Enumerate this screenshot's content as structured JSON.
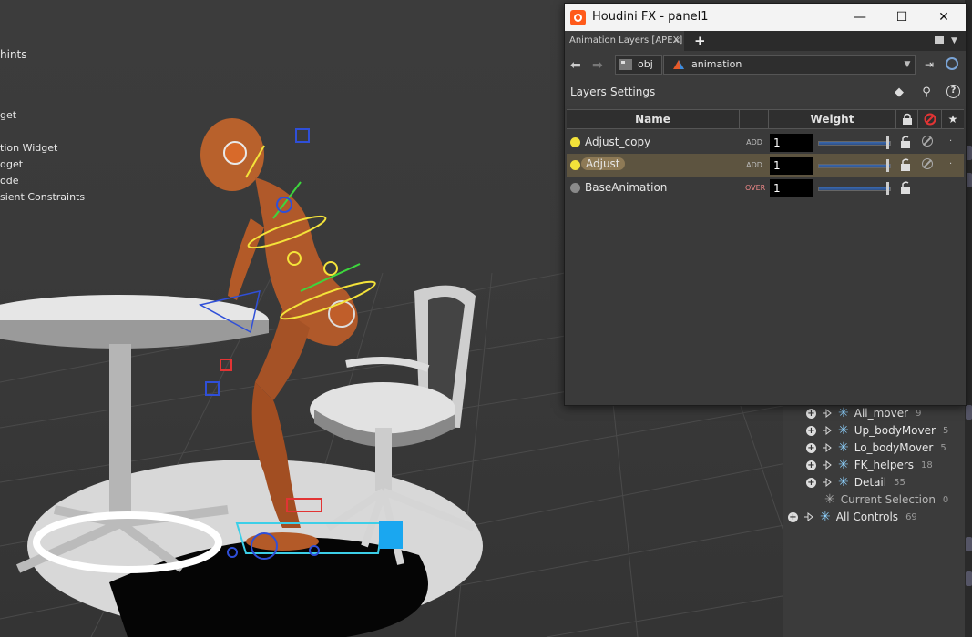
{
  "viewport": {
    "hints": [
      "hints",
      "get",
      "tion Widget",
      "dget",
      "ode",
      "sient Constraints"
    ]
  },
  "channel_tree": {
    "rows": [
      {
        "label": "All_mover",
        "count": "9"
      },
      {
        "label": "Up_bodyMover",
        "count": "5"
      },
      {
        "label": "Lo_bodyMover",
        "count": "5"
      },
      {
        "label": "FK_helpers",
        "count": "18"
      },
      {
        "label": "Detail",
        "count": "55"
      },
      {
        "label": "Current Selection",
        "count": "0"
      },
      {
        "label": "All Controls",
        "count": "69"
      }
    ]
  },
  "window": {
    "title": "Houdini FX - panel1",
    "controls": {
      "minimize": "—",
      "maximize": "☐",
      "close": "✕"
    },
    "tab": {
      "label": "Animation Layers [APEX]",
      "close": "×",
      "add": "+"
    },
    "path": {
      "root": "obj",
      "node": "animation"
    },
    "menu": {
      "layers": "Layers",
      "settings": "Settings"
    },
    "columns": {
      "name": "Name",
      "weight": "Weight"
    },
    "layers": [
      {
        "name": "Adjust_copy",
        "mode": "ADD",
        "weight": "1",
        "weight_fraction": 1.0,
        "dot_color": "#f2e23a"
      },
      {
        "name": "Adjust",
        "mode": "ADD",
        "weight": "1",
        "weight_fraction": 1.0,
        "dot_color": "#f2e23a",
        "selected": true
      },
      {
        "name": "BaseAnimation",
        "mode": "OVER",
        "weight": "1",
        "weight_fraction": 1.0,
        "dot_color": "#8a8a8a"
      }
    ]
  },
  "colors": {
    "accent_selection": "#5d5440",
    "houdini_orange": "#ff5a1a"
  }
}
